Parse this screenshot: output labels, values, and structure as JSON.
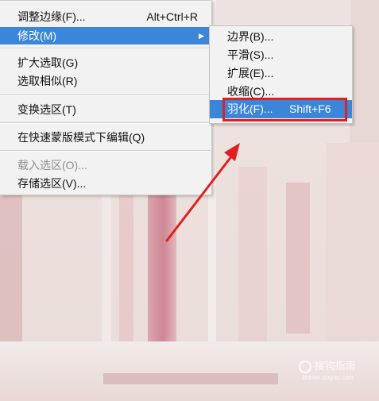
{
  "menu": {
    "items": [
      {
        "label": "调整边缘(F)...",
        "shortcut": "Alt+Ctrl+R"
      },
      {
        "label": "修改(M)",
        "shortcut": ""
      },
      {
        "label": "扩大选取(G)",
        "shortcut": ""
      },
      {
        "label": "选取相似(R)",
        "shortcut": ""
      },
      {
        "label": "变换选区(T)",
        "shortcut": ""
      },
      {
        "label": "在快速蒙版模式下编辑(Q)",
        "shortcut": ""
      },
      {
        "label": "载入选区(O)...",
        "shortcut": ""
      },
      {
        "label": "存储选区(V)...",
        "shortcut": ""
      }
    ],
    "submenu_arrow": "▶"
  },
  "submenu": {
    "items": [
      {
        "label": "边界(B)...",
        "shortcut": ""
      },
      {
        "label": "平滑(S)...",
        "shortcut": ""
      },
      {
        "label": "扩展(E)...",
        "shortcut": ""
      },
      {
        "label": "收缩(C)...",
        "shortcut": ""
      },
      {
        "label": "羽化(F)...",
        "shortcut": "Shift+F6"
      }
    ]
  },
  "annotation": {
    "color": "#e02020"
  },
  "watermark": {
    "text": "搜狗指南",
    "sub": "zhinan.sogou.com"
  },
  "colors": {
    "highlight": "#3b86d9",
    "menu_bg": "#f2f2f2",
    "disabled": "#8e8e8e"
  }
}
